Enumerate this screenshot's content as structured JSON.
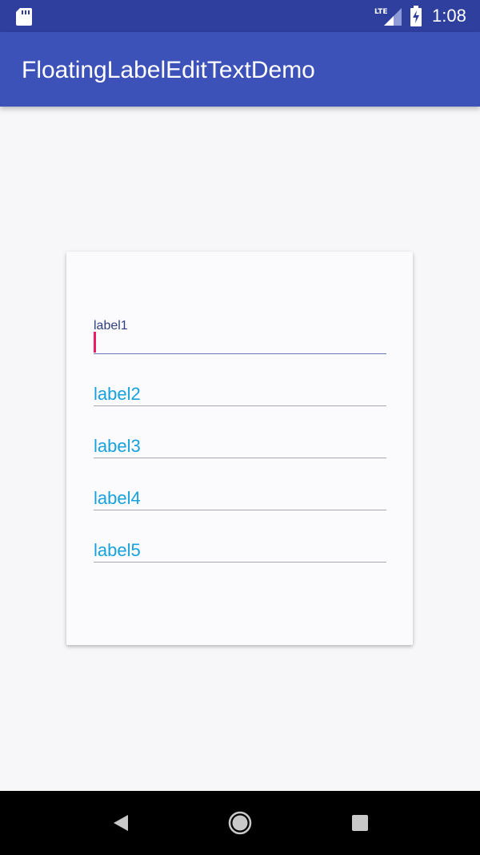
{
  "status_bar": {
    "time": "1:08",
    "network": "LTE",
    "icons": [
      "sd-card-icon",
      "lte-signal-icon",
      "battery-charging-icon"
    ]
  },
  "app_bar": {
    "title": "FloatingLabelEditTextDemo"
  },
  "form": {
    "fields": [
      {
        "label": "label1",
        "state": "focused",
        "value": ""
      },
      {
        "label": "label2",
        "state": "empty",
        "value": ""
      },
      {
        "label": "label3",
        "state": "empty",
        "value": ""
      },
      {
        "label": "label4",
        "state": "empty",
        "value": ""
      },
      {
        "label": "label5",
        "state": "empty",
        "value": ""
      }
    ]
  },
  "nav_bar": {
    "buttons": [
      "back-icon",
      "home-icon",
      "recents-icon"
    ]
  },
  "colors": {
    "status_bar": "#2e3f9e",
    "app_bar": "#3d52b8",
    "label_hint": "#17a2dd",
    "floating_label": "#2f3f7e",
    "cursor": "#e91e63"
  }
}
